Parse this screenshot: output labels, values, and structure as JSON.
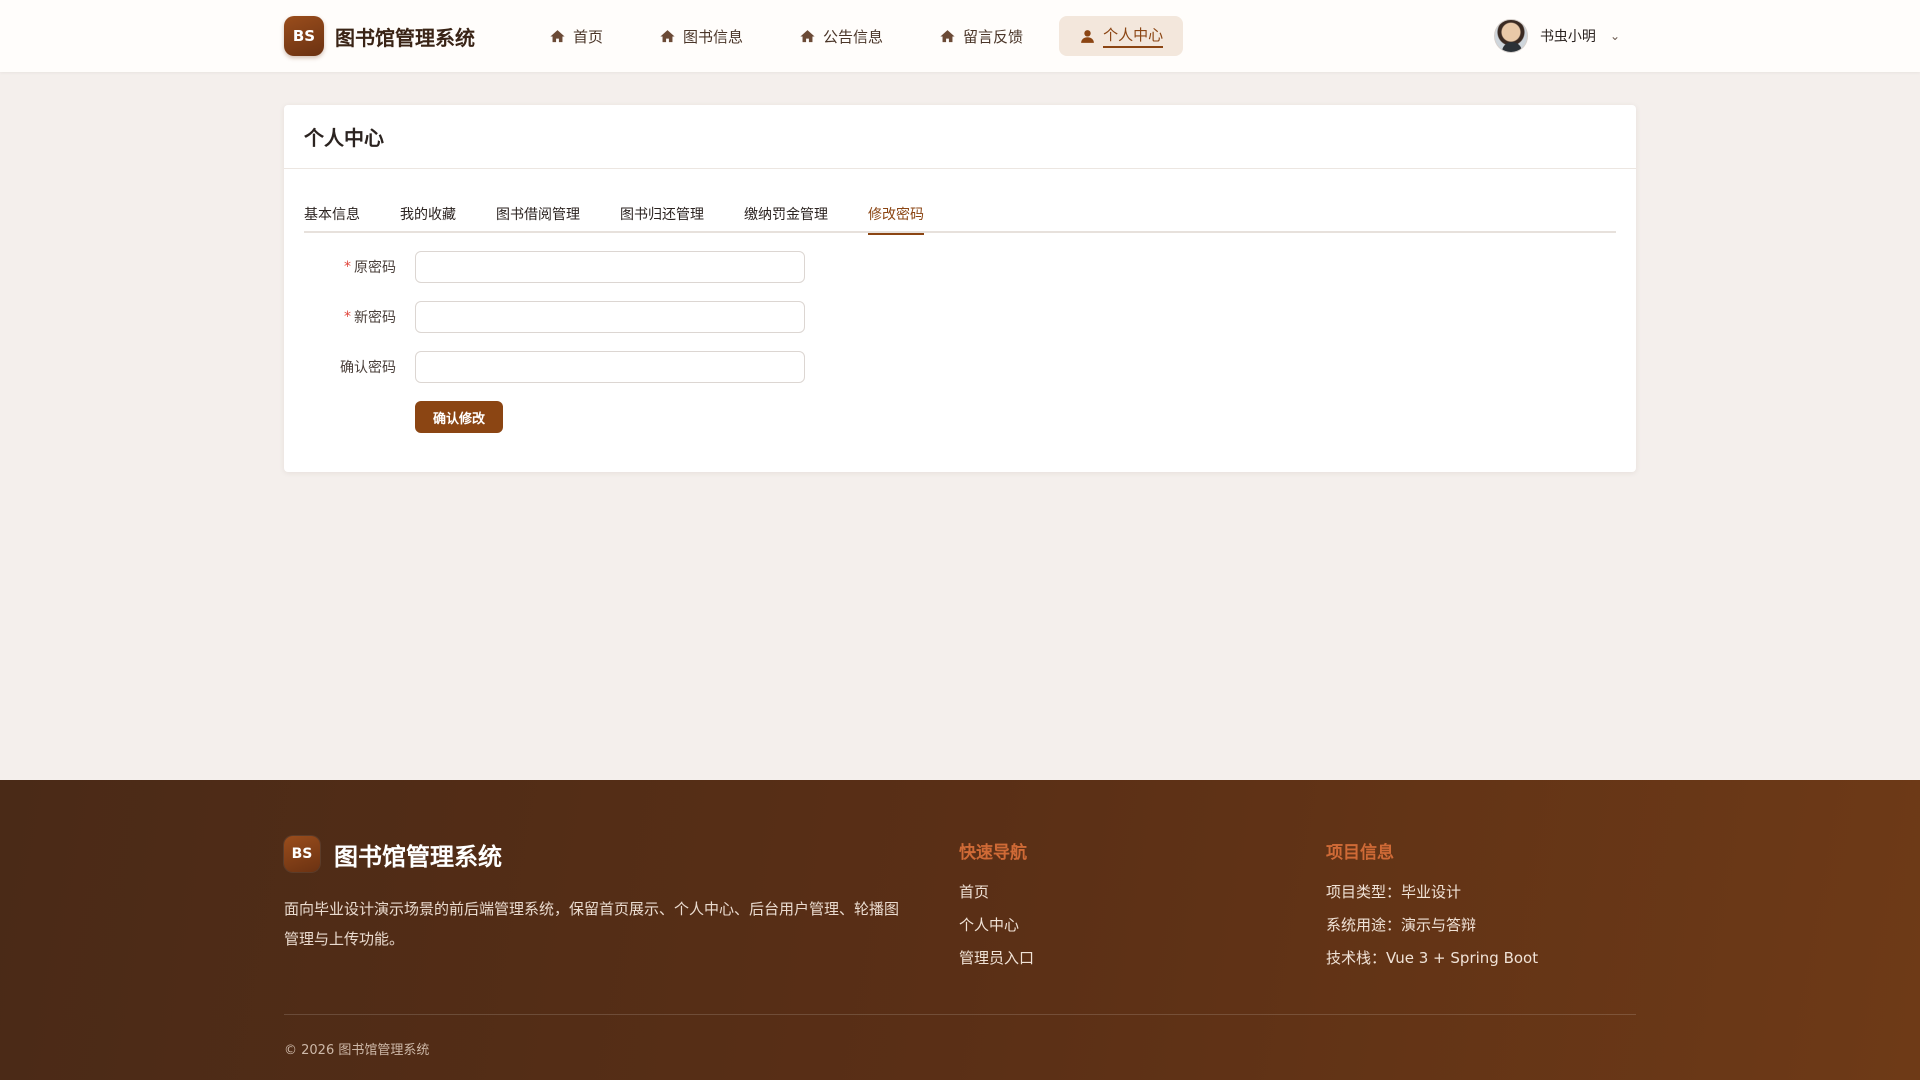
{
  "header": {
    "logo_text": "BS",
    "brand_name": "图书馆管理系统",
    "nav": [
      {
        "label": "首页",
        "icon": "home-icon",
        "active": false
      },
      {
        "label": "图书信息",
        "icon": "home-icon",
        "active": false
      },
      {
        "label": "公告信息",
        "icon": "home-icon",
        "active": false
      },
      {
        "label": "留言反馈",
        "icon": "home-icon",
        "active": false
      },
      {
        "label": "个人中心",
        "icon": "user-icon",
        "active": true
      }
    ],
    "user": {
      "name": "书虫小明",
      "avatar": "user-avatar-photo",
      "caret": "⌄"
    }
  },
  "card": {
    "title": "个人中心",
    "tabs": [
      {
        "label": "基本信息",
        "active": false
      },
      {
        "label": "我的收藏",
        "active": false
      },
      {
        "label": "图书借阅管理",
        "active": false
      },
      {
        "label": "图书归还管理",
        "active": false
      },
      {
        "label": "缴纳罚金管理",
        "active": false
      },
      {
        "label": "修改密码",
        "active": true
      }
    ],
    "form": {
      "required_mark": "*",
      "old_password": {
        "label": "原密码",
        "value": "",
        "required": true
      },
      "new_password": {
        "label": "新密码",
        "value": "",
        "required": true
      },
      "confirm_password": {
        "label": "确认密码",
        "value": "",
        "required": false
      },
      "submit_label": "确认修改"
    }
  },
  "footer": {
    "logo_text": "BS",
    "brand_name": "图书馆管理系统",
    "description": "面向毕业设计演示场景的前后端管理系统，保留首页展示、个人中心、后台用户管理、轮播图管理与上传功能。",
    "quick_nav": {
      "title": "快速导航",
      "links": [
        "首页",
        "个人中心",
        "管理员入口"
      ]
    },
    "project_info": {
      "title": "项目信息",
      "items": [
        "项目类型：毕业设计",
        "系统用途：演示与答辩",
        "技术栈：Vue 3 + Spring Boot"
      ]
    },
    "copyright": "© 2026 图书馆管理系统"
  },
  "colors": {
    "accent": "#8b4513",
    "page_bg": "#f4efec",
    "footer_bg": "#5a2f16",
    "footer_heading": "#cf6a36",
    "required": "#e0443a"
  }
}
